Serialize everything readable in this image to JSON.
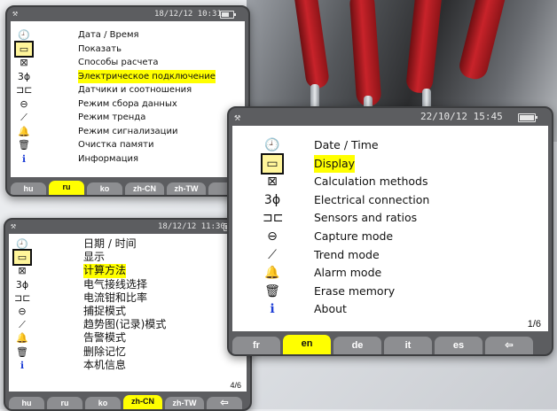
{
  "colors": {
    "highlight": "#ffff00",
    "tab": "#8d8e91",
    "info": "#1f3fd6",
    "frame": "#5c5d60"
  },
  "screen_ru": {
    "status": {
      "datetime": "18/12/12 10:31"
    },
    "items": [
      {
        "icon": "clock-icon",
        "glyph": "🕘",
        "label": "Дата / Время"
      },
      {
        "icon": "display-icon",
        "glyph": "▭",
        "label": "Показать"
      },
      {
        "icon": "calculation-icon",
        "glyph": "⊠",
        "label": "Способы расчета"
      },
      {
        "icon": "three-phase-icon",
        "glyph": "3ϕ",
        "label": "Электрическое подключение"
      },
      {
        "icon": "sensor-icon",
        "glyph": "⊐⊏",
        "label": "Датчики и соотношения"
      },
      {
        "icon": "capture-icon",
        "glyph": "⊖",
        "label": "Режим сбора данных"
      },
      {
        "icon": "trend-icon",
        "glyph": "⟋",
        "label": "Режим тренда"
      },
      {
        "icon": "bell-icon",
        "glyph": "🔔",
        "label": "Режим сигнализации"
      },
      {
        "icon": "trash-icon",
        "glyph": "🗑",
        "label": "Очистка памяти"
      },
      {
        "icon": "info-icon",
        "glyph": "ℹ",
        "label": "Информация"
      }
    ],
    "tabs": [
      "hu",
      "ru",
      "ko",
      "zh-CN",
      "zh-TW",
      ""
    ]
  },
  "screen_zh": {
    "status": {
      "datetime": "18/12/12 11:30"
    },
    "items": [
      {
        "icon": "clock-icon",
        "glyph": "🕘",
        "label": "日期 / 时间"
      },
      {
        "icon": "display-icon",
        "glyph": "▭",
        "label": "显示"
      },
      {
        "icon": "calculation-icon",
        "glyph": "⊠",
        "label": "计算方法"
      },
      {
        "icon": "three-phase-icon",
        "glyph": "3ϕ",
        "label": "电气接线选择"
      },
      {
        "icon": "sensor-icon",
        "glyph": "⊐⊏",
        "label": "电流钳和比率"
      },
      {
        "icon": "capture-icon",
        "glyph": "⊖",
        "label": "捕捉模式"
      },
      {
        "icon": "trend-icon",
        "glyph": "⟋",
        "label": "趋势图(记录)模式"
      },
      {
        "icon": "bell-icon",
        "glyph": "🔔",
        "label": "告警模式"
      },
      {
        "icon": "trash-icon",
        "glyph": "🗑",
        "label": "删除记忆"
      },
      {
        "icon": "info-icon",
        "glyph": "ℹ",
        "label": "本机信息"
      }
    ],
    "page": "4/6",
    "tabs": [
      "hu",
      "ru",
      "ko",
      "zh-CN",
      "zh-TW",
      "⇦"
    ]
  },
  "screen_en": {
    "status": {
      "datetime": "22/10/12 15:45"
    },
    "items": [
      {
        "icon": "clock-icon",
        "glyph": "🕘",
        "label": "Date / Time"
      },
      {
        "icon": "display-icon",
        "glyph": "▭",
        "label": "Display"
      },
      {
        "icon": "calculation-icon",
        "glyph": "⊠",
        "label": "Calculation methods"
      },
      {
        "icon": "three-phase-icon",
        "glyph": "3ϕ",
        "label": "Electrical connection"
      },
      {
        "icon": "sensor-icon",
        "glyph": "⊐⊏",
        "label": "Sensors and ratios"
      },
      {
        "icon": "capture-icon",
        "glyph": "⊖",
        "label": "Capture mode"
      },
      {
        "icon": "trend-icon",
        "glyph": "⟋",
        "label": "Trend mode"
      },
      {
        "icon": "bell-icon",
        "glyph": "🔔",
        "label": "Alarm mode"
      },
      {
        "icon": "trash-icon",
        "glyph": "🗑",
        "label": "Erase memory"
      },
      {
        "icon": "info-icon",
        "glyph": "ℹ",
        "label": "About"
      }
    ],
    "page": "1/6",
    "tabs": [
      "fr",
      "en",
      "de",
      "it",
      "es",
      "⇦"
    ]
  }
}
